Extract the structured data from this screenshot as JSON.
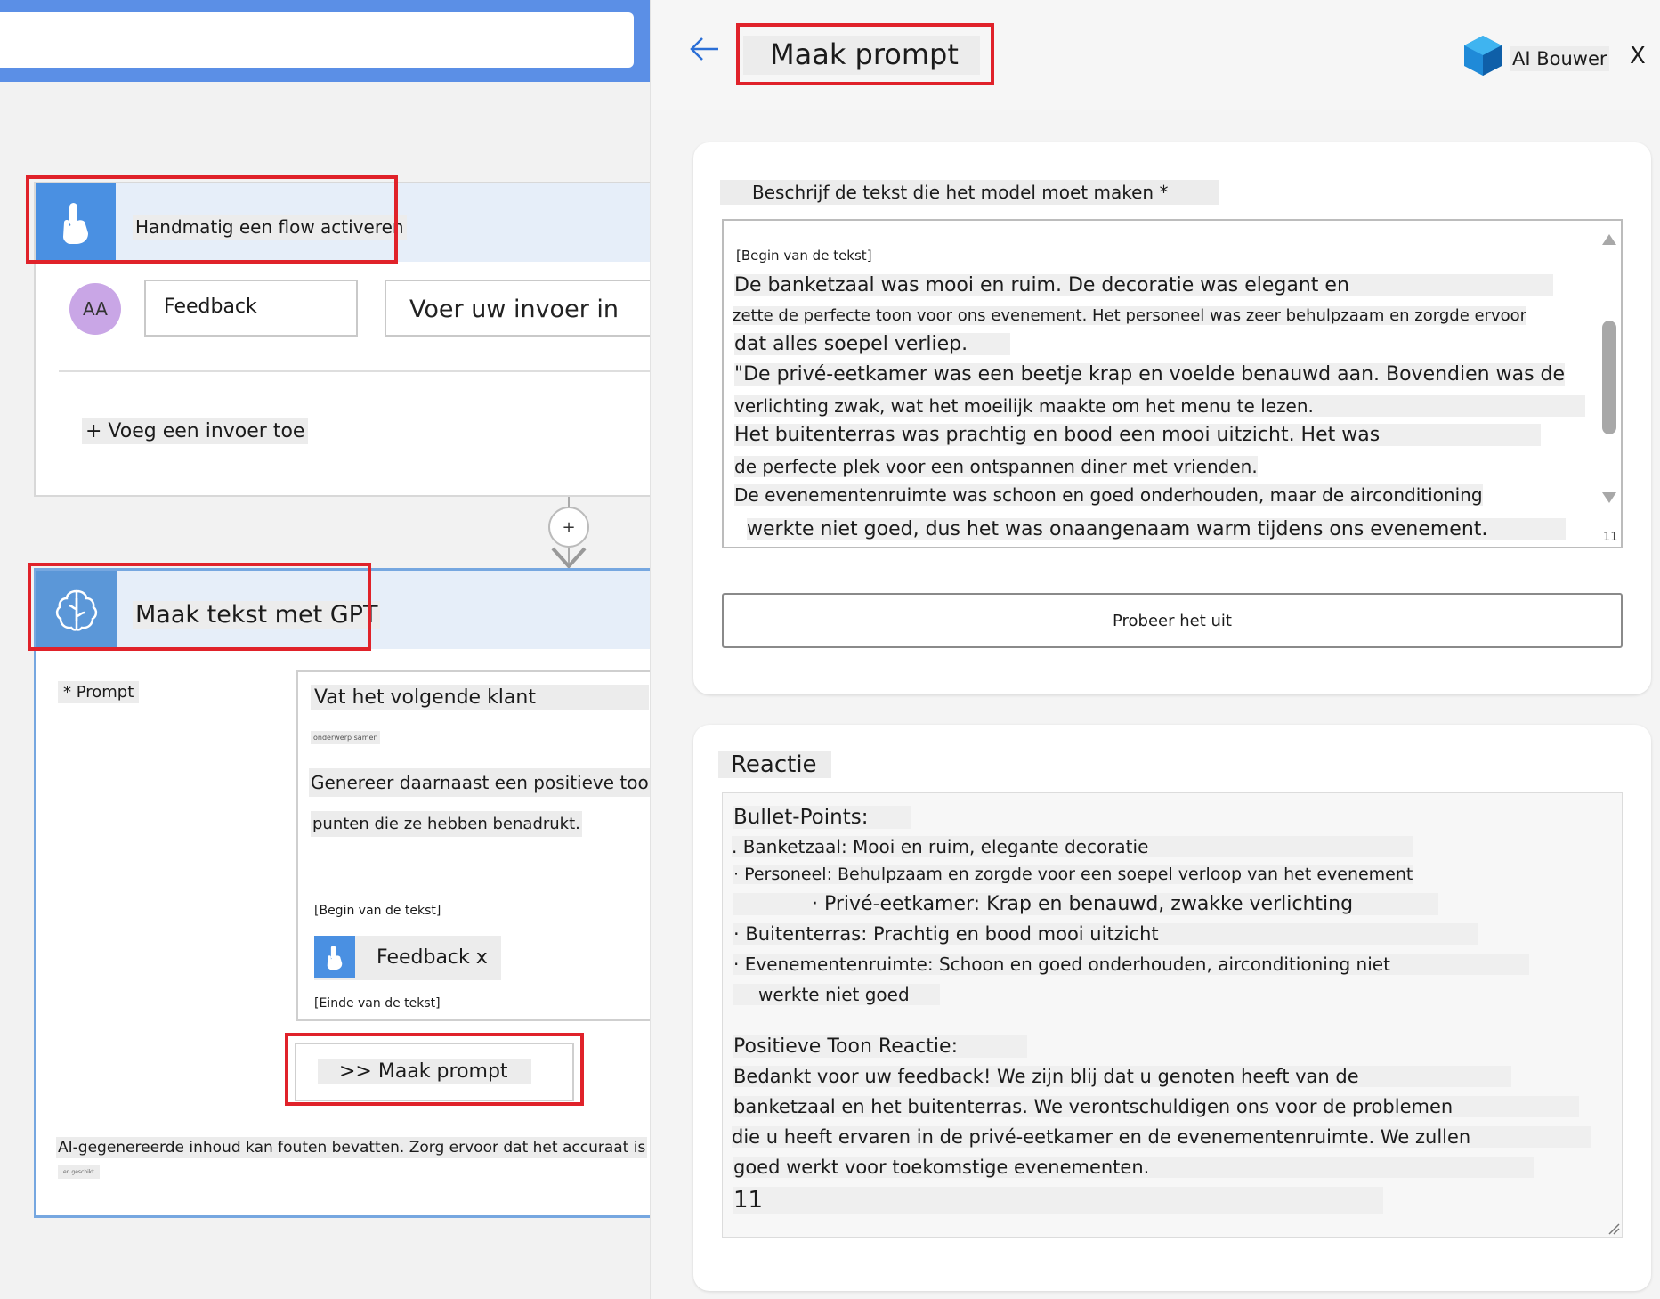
{
  "flow": {
    "trigger": {
      "title": "Handmatig een flow activeren"
    },
    "input": {
      "avatar": "AA",
      "name": "Feedback",
      "placeholder": "Voer uw invoer in",
      "add_input": "+ Voeg een invoer toe"
    },
    "add_step": "+",
    "gpt": {
      "title": "Maak tekst met GPT",
      "prompt_label": "* Prompt",
      "prompt_lines": [
        "Vat het volgende klant",
        "onderwerp samen",
        "Genereer daarnaast een positieve toon",
        "punten die ze hebben benadrukt."
      ],
      "begin": "[Begin van de tekst]",
      "token": "Feedback x",
      "end": "[Einde van de tekst]",
      "make_prompt_button": ">> Maak prompt",
      "disclaimer": "AI-gegenereerde inhoud kan fouten bevatten. Zorg ervoor dat het accuraat is",
      "disclaimer_sub": "en geschikt"
    }
  },
  "panel": {
    "back": "←",
    "title": "Maak prompt",
    "brand": "AI Bouwer",
    "close": "X",
    "describe_label": "Beschrijf de tekst die het model moet maken *",
    "text_lines": [
      "[Begin van de tekst]",
      "De banketzaal was mooi en ruim. De decoratie was elegant en",
      "zette de perfecte toon voor ons evenement. Het personeel was zeer behulpzaam en zorgde ervoor",
      "dat alles soepel verliep.",
      "\"De privé-eetkamer was een beetje krap en voelde benauwd aan. Bovendien was de",
      "verlichting zwak, wat het moeilijk maakte om het menu te lezen.",
      "Het buitenterras was prachtig en bood een mooi uitzicht. Het was",
      "de perfecte plek voor een ontspannen diner met vrienden.",
      "De evenementenruimte was schoon en goed onderhouden, maar de airconditioning",
      "werkte niet goed, dus het was onaangenaam warm tijdens ons evenement."
    ],
    "char_count": "11",
    "try_button": "Probeer het uit",
    "response_label": "Reactie",
    "response_lines": [
      "Bullet-Points:",
      ". Banketzaal: Mooi en ruim, elegante decoratie",
      "· Personeel: Behulpzaam en zorgde voor een soepel verloop van het evenement",
      "· Privé-eetkamer: Krap en benauwd, zwakke verlichting",
      "· Buitenterras: Prachtig en bood mooi uitzicht",
      "· Evenementenruimte: Schoon en goed onderhouden, airconditioning niet",
      "werkte niet goed",
      "Positieve Toon Reactie:",
      "Bedankt voor uw feedback! We zijn blij dat u genoten heeft van de",
      "banketzaal en het buitenterras. We verontschuldigen ons voor de problemen",
      "die u heeft ervaren in de privé-eetkamer en de evenementenruimte. We zullen",
      "goed werkt voor toekomstige evenementen.",
      "11"
    ]
  }
}
